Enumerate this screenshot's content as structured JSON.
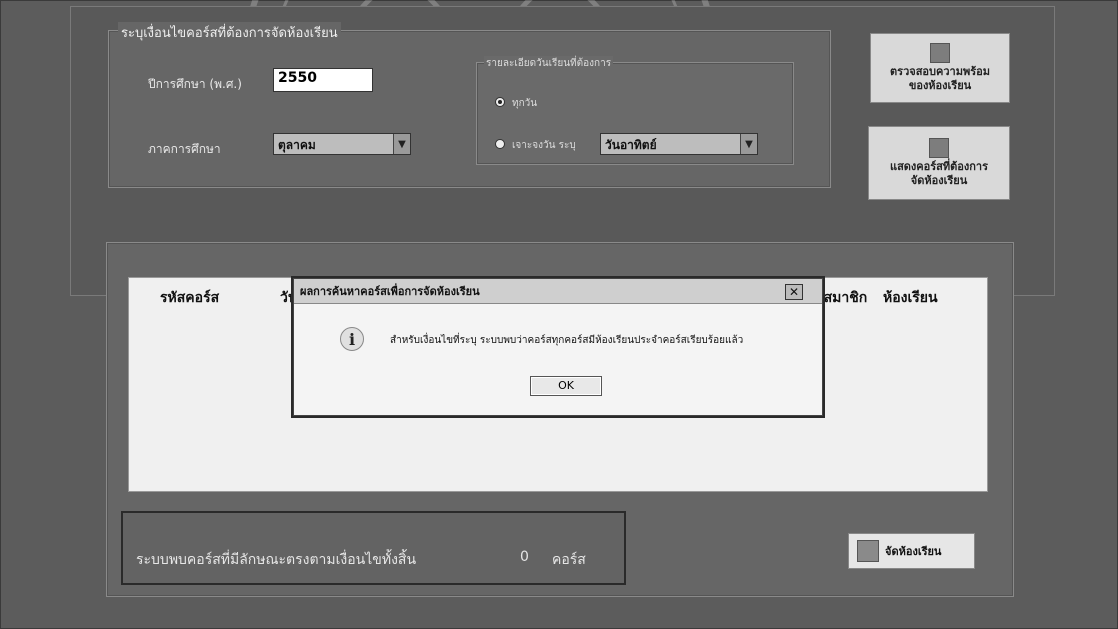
{
  "criteria": {
    "title": "ระบุเงื่อนไขคอร์สที่ต้องการจัดห้องเรียน",
    "year_label": "ปีการศึกษา (พ.ศ.)",
    "year_value": "2550",
    "semester_label": "ภาคการศึกษา",
    "semester_value": "ตุลาคม",
    "days_group_title": "รายละเอียดวันเรียนที่ต้องการ",
    "option_every_day": "ทุกวัน",
    "option_specific_day": "เจาะจงวัน ระบุ",
    "specific_day_value": "วันอาทิตย์"
  },
  "side_buttons": {
    "check_ready_line1": "ตรวจสอบความพร้อม",
    "check_ready_line2": "ของห้องเรียน",
    "show_courses_line1": "แสดงคอร์สที่ต้องการ",
    "show_courses_line2": "จัดห้องเรียน"
  },
  "results": {
    "col_course_code": "รหัสคอร์ส",
    "col_date": "วันเรี",
    "col_members": "นสมาชิก",
    "col_room": "ห้องเรียน"
  },
  "dialog": {
    "title": "ผลการค้นหาคอร์สเพื่อการจัดห้องเรียน",
    "message": "สำหรับเงื่อนไขที่ระบุ ระบบพบว่าคอร์สทุกคอร์สมีห้องเรียนประจำคอร์สเรียบร้อยแล้ว",
    "ok_label": "OK",
    "close_label": "✕"
  },
  "status": {
    "prefix": "ระบบพบคอร์สที่มีลักษณะตรงตามเงื่อนไขทั้งสิ้น",
    "count": "0",
    "suffix": "คอร์ส"
  },
  "action": {
    "assign_rooms_label": "จัดห้องเรียน"
  },
  "colors": {
    "background": "#5c5c5c",
    "dialog": "#f4f4f4"
  }
}
